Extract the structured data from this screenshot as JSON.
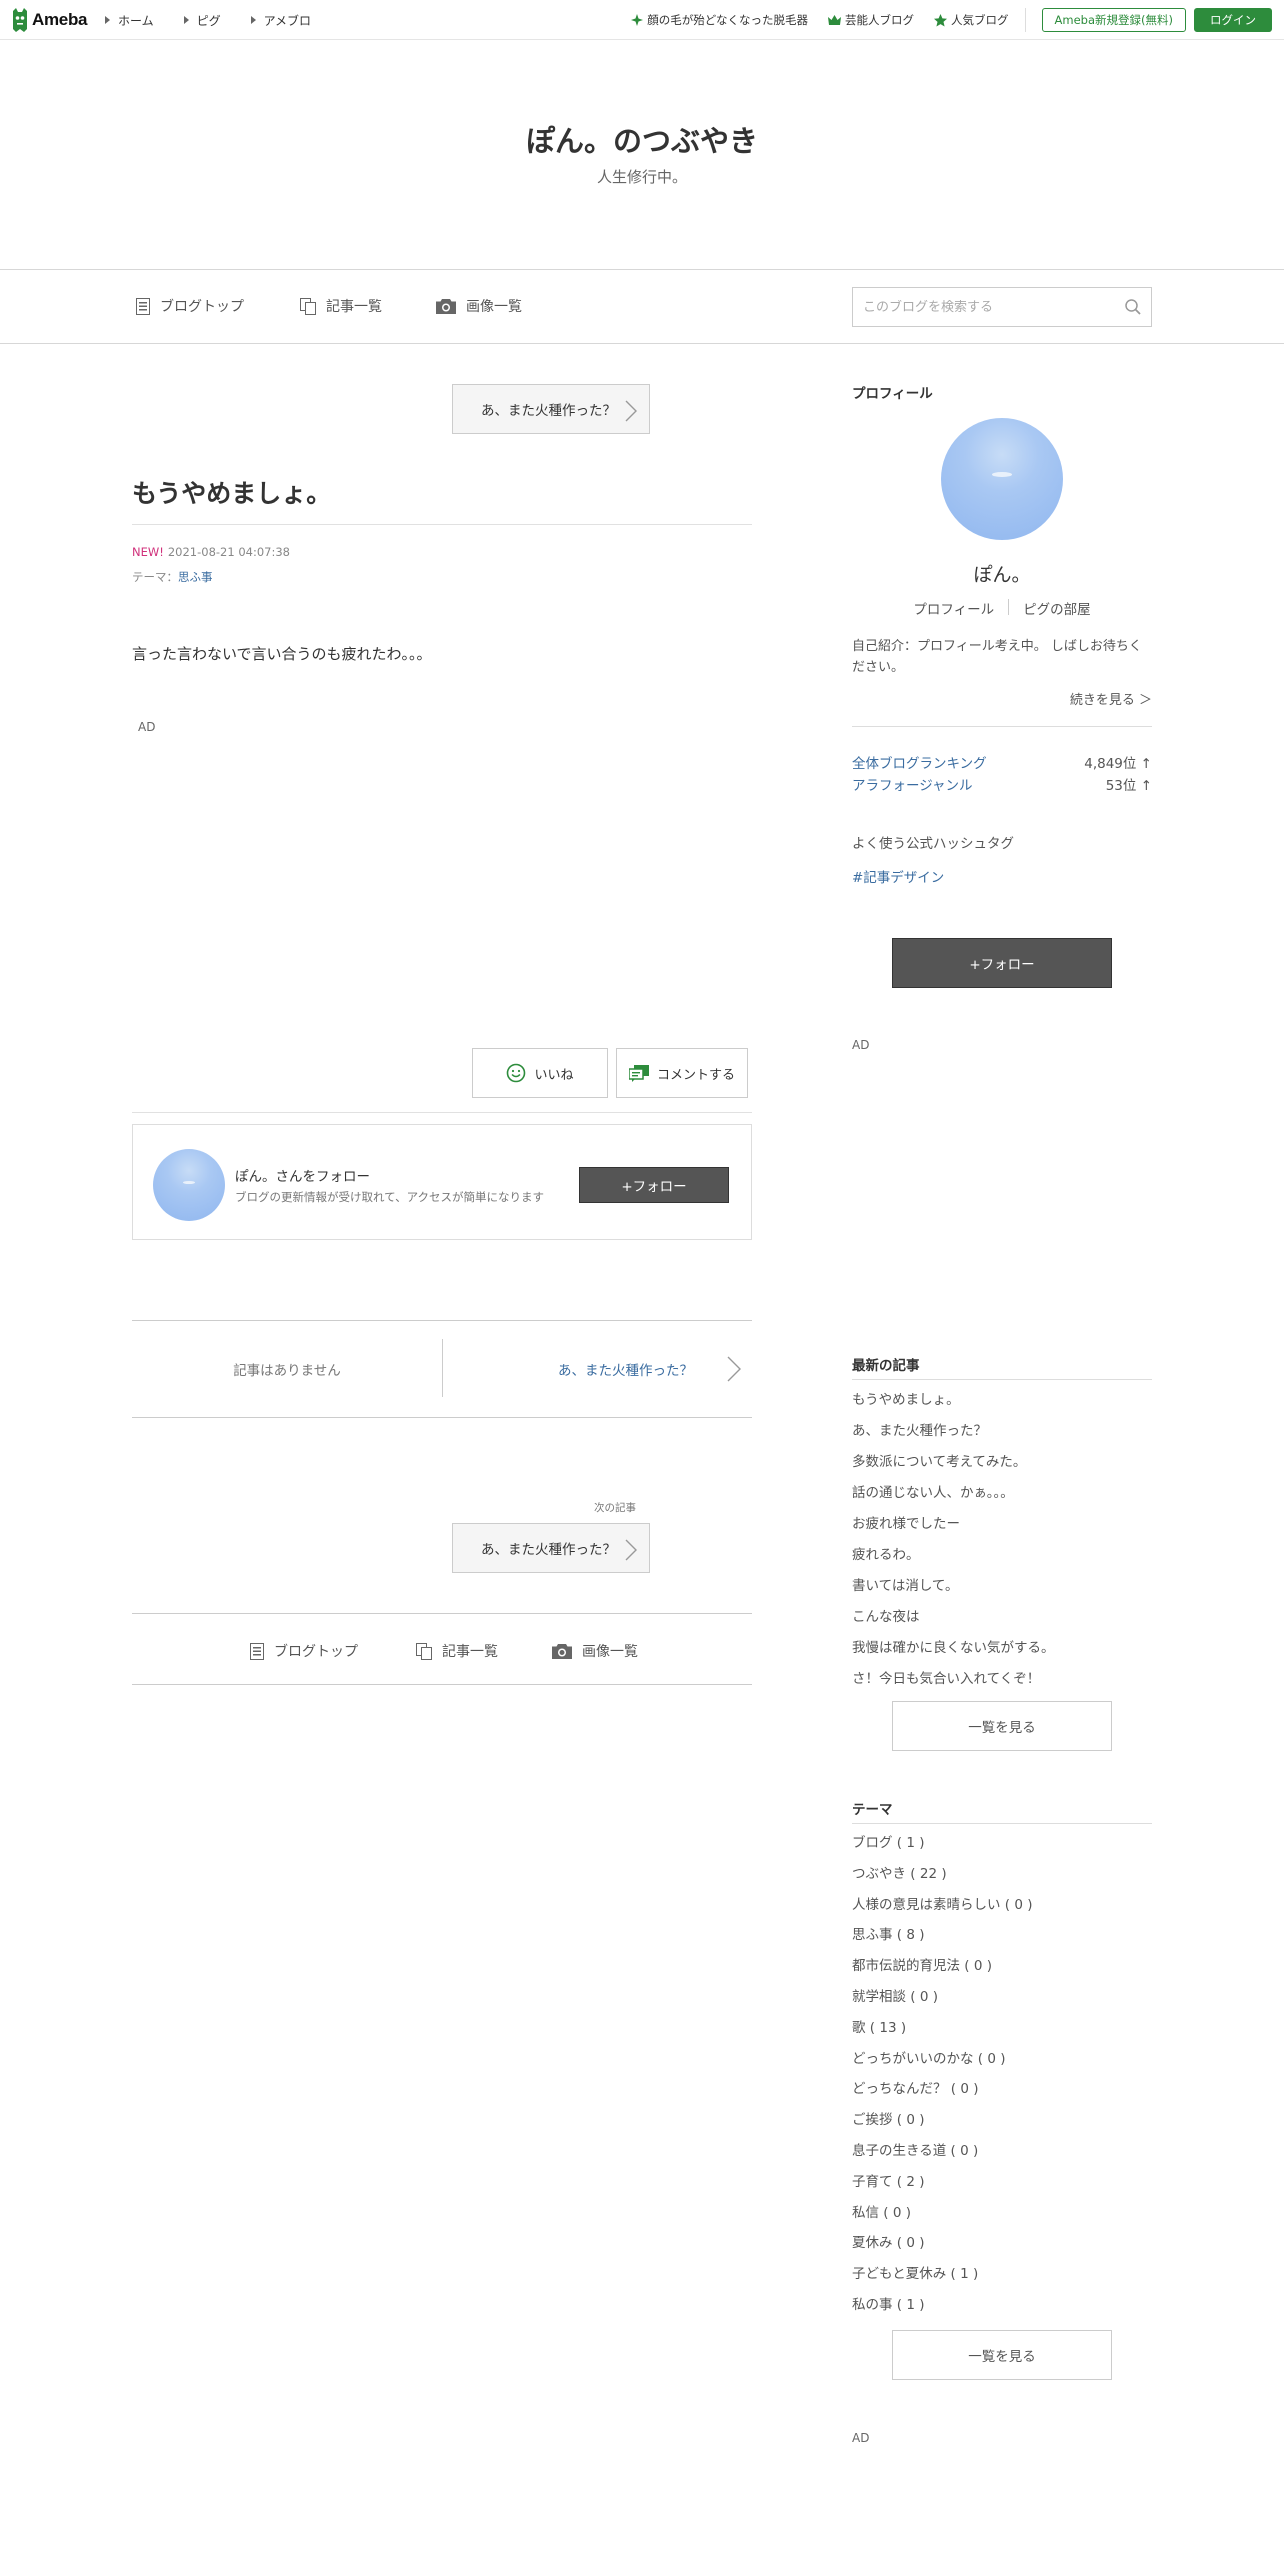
{
  "topbar": {
    "logo_text": "Ameba",
    "nav": [
      "ホーム",
      "ピグ",
      "アメブロ"
    ],
    "links": [
      {
        "label": "顔の毛が殆どなくなった脱毛器",
        "icon": "plus-icon"
      },
      {
        "label": "芸能人ブログ",
        "icon": "crown-icon"
      },
      {
        "label": "人気ブログ",
        "icon": "star-icon"
      }
    ],
    "register": "Ameba新規登録(無料)",
    "login": "ログイン",
    "accent": "#2d8c3c"
  },
  "header": {
    "title": "ぽん。のつぶやき",
    "description": "人生修行中。"
  },
  "gnav": {
    "items": [
      "ブログトップ",
      "記事一覧",
      "画像一覧"
    ],
    "search_placeholder": "このブログを検索する"
  },
  "article": {
    "prev_entry": "あ、また火種作った？",
    "title": "もうやめましょ。",
    "new_badge": "NEW!",
    "datetime": "2021-08-21 04:07:38",
    "theme_label": "テーマ：",
    "theme": "思ふ事",
    "body": "言った言わないで言い合うのも疲れたわ。。。",
    "ad": "AD",
    "like": "いいね",
    "comment": "コメントする",
    "follow_card": {
      "name": "ぽん。さんをフォロー",
      "desc": "ブログの更新情報が受け取れて、アクセスが簡単になります",
      "button": "+フォロー"
    },
    "pager": {
      "none": "記事はありません",
      "next": "あ、また火種作った？"
    },
    "next_label": "次の記事",
    "next_entry": "あ、また火種作った？",
    "bottom_nav": [
      "ブログトップ",
      "記事一覧",
      "画像一覧"
    ]
  },
  "sidebar": {
    "profile_heading": "プロフィール",
    "name": "ぽん。",
    "links": [
      "プロフィール",
      "ピグの部屋"
    ],
    "intro": "自己紹介：プロフィール考え中。 しばしお待ちください。",
    "more": "続きを見る ＞",
    "rankings": [
      {
        "label": "全体ブログランキング",
        "value": "4,849位 ↑"
      },
      {
        "label": "アラフォージャンル",
        "value": "53位 ↑"
      }
    ],
    "hashtag_heading": "よく使う公式ハッシュタグ",
    "hashtag": "#記事デザイン",
    "follow": "+フォロー",
    "ad": "AD",
    "recent_heading": "最新の記事",
    "recent": [
      "もうやめましょ。",
      "あ、また火種作った？",
      "多数派について考えてみた。",
      "話の通じない人、かぁ。。。",
      "お疲れ様でしたー",
      "疲れるわ。",
      "書いては消して。",
      "こんな夜は",
      "我慢は確かに良くない気がする。",
      "さ！今日も気合い入れてくぞ！"
    ],
    "recent_more": "一覧を見る",
    "theme_heading": "テーマ",
    "themes": [
      "ブログ ( 1 )",
      "つぶやき ( 22 )",
      "人様の意見は素晴らしい ( 0 )",
      "思ふ事 ( 8 )",
      "都市伝説的育児法 ( 0 )",
      "就学相談 ( 0 )",
      "歌 ( 13 )",
      "どっちがいいのかな ( 0 )",
      "どっちなんだ？ ( 0 )",
      "ご挨拶 ( 0 )",
      "息子の生きる道 ( 0 )",
      "子育て ( 2 )",
      "私信 ( 0 )",
      "夏休み ( 0 )",
      "子どもと夏休み ( 1 )",
      "私の事 ( 1 )"
    ],
    "theme_more": "一覧を見る",
    "ad2": "AD"
  }
}
